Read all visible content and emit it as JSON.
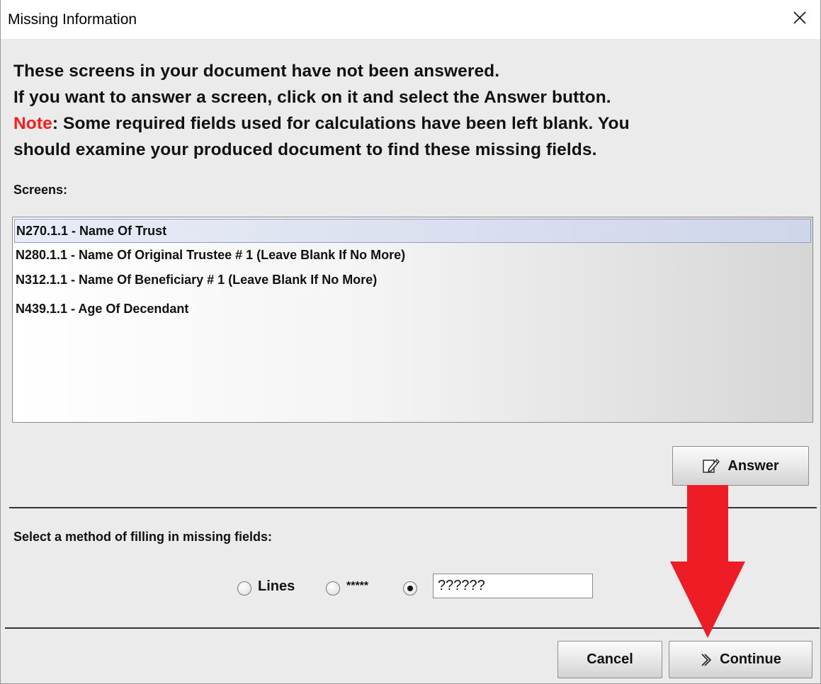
{
  "window": {
    "title": "Missing Information",
    "close_icon": "close-icon"
  },
  "intro": {
    "line1": "These screens in your document have not been answered.",
    "line2": "If you want to answer a screen, click on it and select the Answer button.",
    "note_label": "Note",
    "line3_rest": ": Some required fields used for calculations have been left blank. You",
    "line4": "should examine your produced document to find these missing fields."
  },
  "screens": {
    "label": "Screens:",
    "items": [
      {
        "label": "N270.1.1 - Name Of Trust",
        "selected": true
      },
      {
        "label": "N280.1.1 - Name Of Original Trustee # 1 (Leave Blank If No More)",
        "selected": false
      },
      {
        "label": "N312.1.1 - Name Of Beneficiary # 1 (Leave Blank If No More)",
        "selected": false
      },
      {
        "label": "N439.1.1 - Age Of Decendant",
        "selected": false
      }
    ]
  },
  "answer_button": {
    "label": "Answer",
    "icon": "edit-icon"
  },
  "fill_method": {
    "label": "Select a method of filling in missing fields:",
    "options": [
      {
        "label": "Lines",
        "checked": false
      },
      {
        "label": "*****",
        "checked": false
      },
      {
        "label": "",
        "checked": true
      }
    ],
    "custom_value": "??????"
  },
  "footer": {
    "cancel_label": "Cancel",
    "continue_label": "Continue",
    "continue_icon": "chevron-right-icon"
  },
  "colors": {
    "note": "#ff1a1a",
    "annotation_arrow": "#ee1c25",
    "selection": "#cfd6ea"
  }
}
